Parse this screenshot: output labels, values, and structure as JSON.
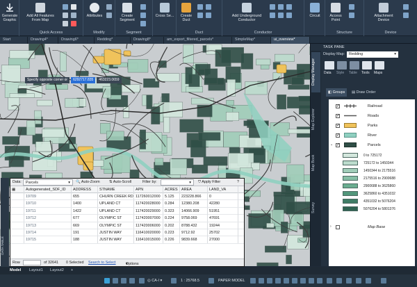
{
  "ribbon": {
    "groups": [
      {
        "label": "",
        "buttons": [
          {
            "label": "Generate\nGraphic"
          }
        ]
      },
      {
        "label": "Quick Access",
        "buttons": [
          {
            "label": "Add All Features\nFrom Map"
          }
        ]
      },
      {
        "label": "Modify",
        "buttons": [
          {
            "label": "Attributes"
          }
        ]
      },
      {
        "label": "Segment",
        "buttons": [
          {
            "label": "Create\nSegment"
          }
        ]
      },
      {
        "label": "",
        "buttons": [
          {
            "label": "Cross Se..."
          }
        ]
      },
      {
        "label": "Duct",
        "buttons": [
          {
            "label": "Create\nDuct"
          }
        ]
      },
      {
        "label": "Conductor",
        "buttons": [
          {
            "label": "Add Underground\nConductor"
          }
        ]
      },
      {
        "label": "",
        "buttons": [
          {
            "label": "Circuit"
          }
        ]
      },
      {
        "label": "Structure",
        "buttons": [
          {
            "label": "Access\nPoint"
          }
        ]
      },
      {
        "label": "Device",
        "buttons": [
          {
            "label": "Attachment\nDevice"
          }
        ]
      }
    ]
  },
  "doc_tabs": [
    "Start",
    "Drawing4*",
    "Drawing6*",
    "Redding*",
    "Drawing8*",
    "am_export_filtered_parcels*",
    "SimpleMap*",
    "ui_overview*"
  ],
  "active_tab": "ui_overview*",
  "map": {
    "tooltip_prompt": "Specify opposite corner or",
    "coord_x": "6292717.835",
    "coord_y": "463223.0659",
    "colors": {
      "background": "#c9cdd0",
      "roads": "#3f3f3f",
      "parks": "#f0c35b",
      "river": "#8fd0c0",
      "parcel_dark": "#2f4e46",
      "parcel_light": "#d9e8de"
    }
  },
  "data_table": {
    "data_label": "Data:",
    "data_source": "Parcels",
    "auto_zoom": "Auto-Zoom",
    "auto_scroll": "Auto-Scroll",
    "filter_by": "Filter by:",
    "apply_filter": "Apply Filter",
    "help": "?",
    "columns": [
      "Autogenerated_SDF_ID",
      "ADDRESS",
      "STNAME",
      "APN",
      "ACRES",
      "AREA",
      "LAND_VA"
    ],
    "rows": [
      [
        "19709",
        "655",
        "CHURN CREEK RD",
        "117260012000",
        "5.125",
        "223228.866",
        "0"
      ],
      [
        "19710",
        "1400",
        "UPLAND CT",
        "117420028000",
        "0.284",
        "12380.208",
        "42280"
      ],
      [
        "19711",
        "1422",
        "UPLAND CT",
        "117420029000",
        "0.323",
        "14066.909",
        "51951"
      ],
      [
        "19712",
        "677",
        "OLYMPIC ST",
        "117420007000",
        "0.224",
        "9758.069",
        "47691"
      ],
      [
        "19713",
        "669",
        "OLYMPIC ST",
        "117420006000",
        "0.202",
        "8788.432",
        "19244"
      ],
      [
        "19714",
        "191",
        "JUSTIN WAY",
        "116410020000",
        "0.223",
        "9712.92",
        "25702"
      ],
      [
        "19715",
        "188",
        "JUSTIN WAY",
        "116410015000",
        "0.226",
        "9839.668",
        "27000"
      ]
    ],
    "footer": {
      "row_label": "Row",
      "of_count": "of 32641",
      "selected": "0 Selected",
      "search_to_select": "Search to Select",
      "options": "Options"
    },
    "side_label": "DATA TABLE"
  },
  "task_pane": {
    "title": "TASK PANE",
    "display_map_label": "Display Map:",
    "display_map_value": "Redding",
    "tools": [
      "Data",
      "Style",
      "Table",
      "Tools",
      "Maps"
    ],
    "groups_tab": "Groups",
    "draw_order_tab": "Draw Order",
    "vertical_tabs": [
      "Display Manager",
      "Map Explorer",
      "Map Book",
      "Survey"
    ],
    "layers": [
      {
        "name": "Railroad",
        "checked": true,
        "symbol": "line"
      },
      {
        "name": "Roads",
        "checked": true,
        "symbol": "line"
      },
      {
        "name": "Parks",
        "checked": true,
        "symbol": "fill",
        "color": "#f0c35b"
      },
      {
        "name": "River",
        "checked": true,
        "symbol": "fill",
        "color": "#8fd0c0"
      },
      {
        "name": "Parcels",
        "checked": true,
        "symbol": "fill",
        "color": "#2f4e46"
      }
    ],
    "legend": [
      {
        "label": "0 to 725172",
        "color": "#d4e8de"
      },
      {
        "label": "725172 to 1450344",
        "color": "#bcdccd"
      },
      {
        "label": "1450344 to 2175516",
        "color": "#a1cdb9"
      },
      {
        "label": "2175516 to 2900688",
        "color": "#86bea5"
      },
      {
        "label": "2900688 to 3625860",
        "color": "#6aad90"
      },
      {
        "label": "3625860 to 4351032",
        "color": "#52977b"
      },
      {
        "label": "4351032 to 5076204",
        "color": "#3f7d66"
      },
      {
        "label": "5076204 to 5801376",
        "color": "#2f6352"
      }
    ],
    "map_base": "Map Base"
  },
  "status": {
    "layout_tabs": [
      "Model",
      "Layout1",
      "Layout2",
      "+"
    ],
    "coord_system": "CA-I",
    "scale": "1 : 25768.5",
    "paper_model": "PAPER MODEL"
  }
}
